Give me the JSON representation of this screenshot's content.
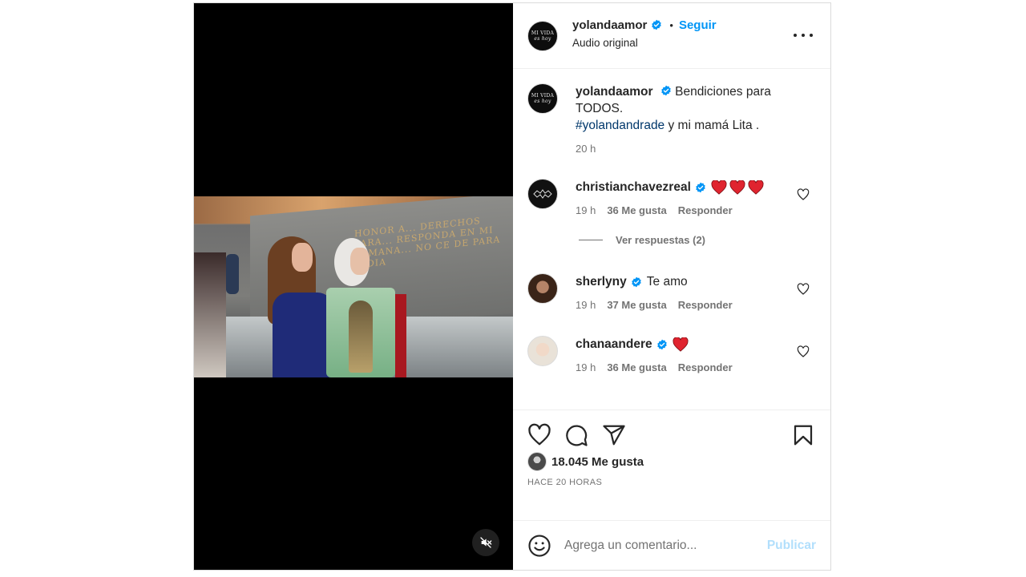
{
  "post": {
    "author": {
      "username": "yolandaamor",
      "verified": true,
      "avatar_logo_line1": "MI VIDA",
      "avatar_logo_line2": "es hoy",
      "audio": "Audio original"
    },
    "follow_label": "Seguir",
    "separator": "•",
    "caption": {
      "username": "yolandaamor",
      "text_line1": "Bendiciones para",
      "text_line2": "TODOS.",
      "hashtag": "#yolandandrade",
      "text_after_hashtag": " y mi mamá Lita .",
      "time": "20 h"
    },
    "video": {
      "muted": true,
      "inscription": "HONOR A... DERECHOS PARA... RESPONDA EN MI SEMANA... NO CE DE PARA INDIA"
    }
  },
  "comments": [
    {
      "username": "christianchavezreal",
      "verified": true,
      "text": "",
      "hearts": 3,
      "time": "19 h",
      "likes": "36 Me gusta",
      "reply": "Responder"
    },
    {
      "username": "sherlyny",
      "verified": true,
      "text": "Te amo",
      "hearts": 0,
      "time": "19 h",
      "likes": "37 Me gusta",
      "reply": "Responder"
    },
    {
      "username": "chanaandere",
      "verified": true,
      "text": "",
      "hearts": 1,
      "time": "19 h",
      "likes": "36 Me gusta",
      "reply": "Responder"
    }
  ],
  "view_replies": "Ver respuestas (2)",
  "footer": {
    "likes": "18.045 Me gusta",
    "time_ago": "HACE 20 HORAS",
    "comment_placeholder": "Agrega un comentario...",
    "publish_label": "Publicar"
  },
  "colors": {
    "accent": "#0095f6",
    "verified": "#0095f6",
    "heart_red": "#e0242f",
    "publish_disabled": "#b2dffc"
  },
  "icons": [
    "verified-badge-icon",
    "more-options-icon",
    "heart-icon",
    "comment-icon",
    "share-icon",
    "bookmark-icon",
    "emoji-icon",
    "muted-speaker-icon",
    "red-heart-emoji-icon"
  ]
}
